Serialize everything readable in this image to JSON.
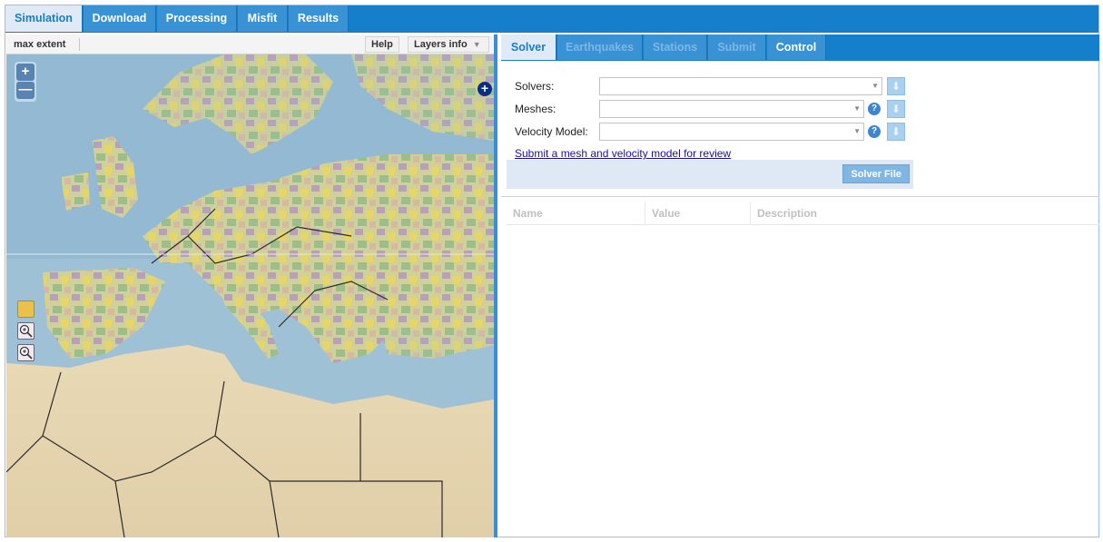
{
  "top_tabs": [
    "Simulation",
    "Download",
    "Processing",
    "Misfit",
    "Results"
  ],
  "map_toolbar": {
    "max_extent_label": "max extent",
    "help_label": "Help",
    "layers_info_label": "Layers info"
  },
  "map_controls": {
    "zoom_in": "+",
    "zoom_out": "—",
    "layer_switcher": "+"
  },
  "right_tabs": [
    "Solver",
    "Earthquakes",
    "Stations",
    "Submit",
    "Control"
  ],
  "solver_form": {
    "solvers_label": "Solvers:",
    "meshes_label": "Meshes:",
    "velocity_model_label": "Velocity Model:",
    "help_glyph": "?",
    "submit_link": "Submit a mesh and velocity model for review",
    "solver_file_button": "Solver File"
  },
  "grid": {
    "columns": [
      "Name",
      "Value",
      "Description"
    ]
  },
  "colors": {
    "accent": "#157fcc",
    "active_tab_bg": "#dfeaf6",
    "sea": "#a7c7dc",
    "land": "#e4d6b4"
  },
  "icons": [
    "pan-icon",
    "zoom-box-icon",
    "zoom-extent-icon",
    "help-icon",
    "download-icon",
    "chevron-down-icon",
    "layers-plus-icon"
  ]
}
